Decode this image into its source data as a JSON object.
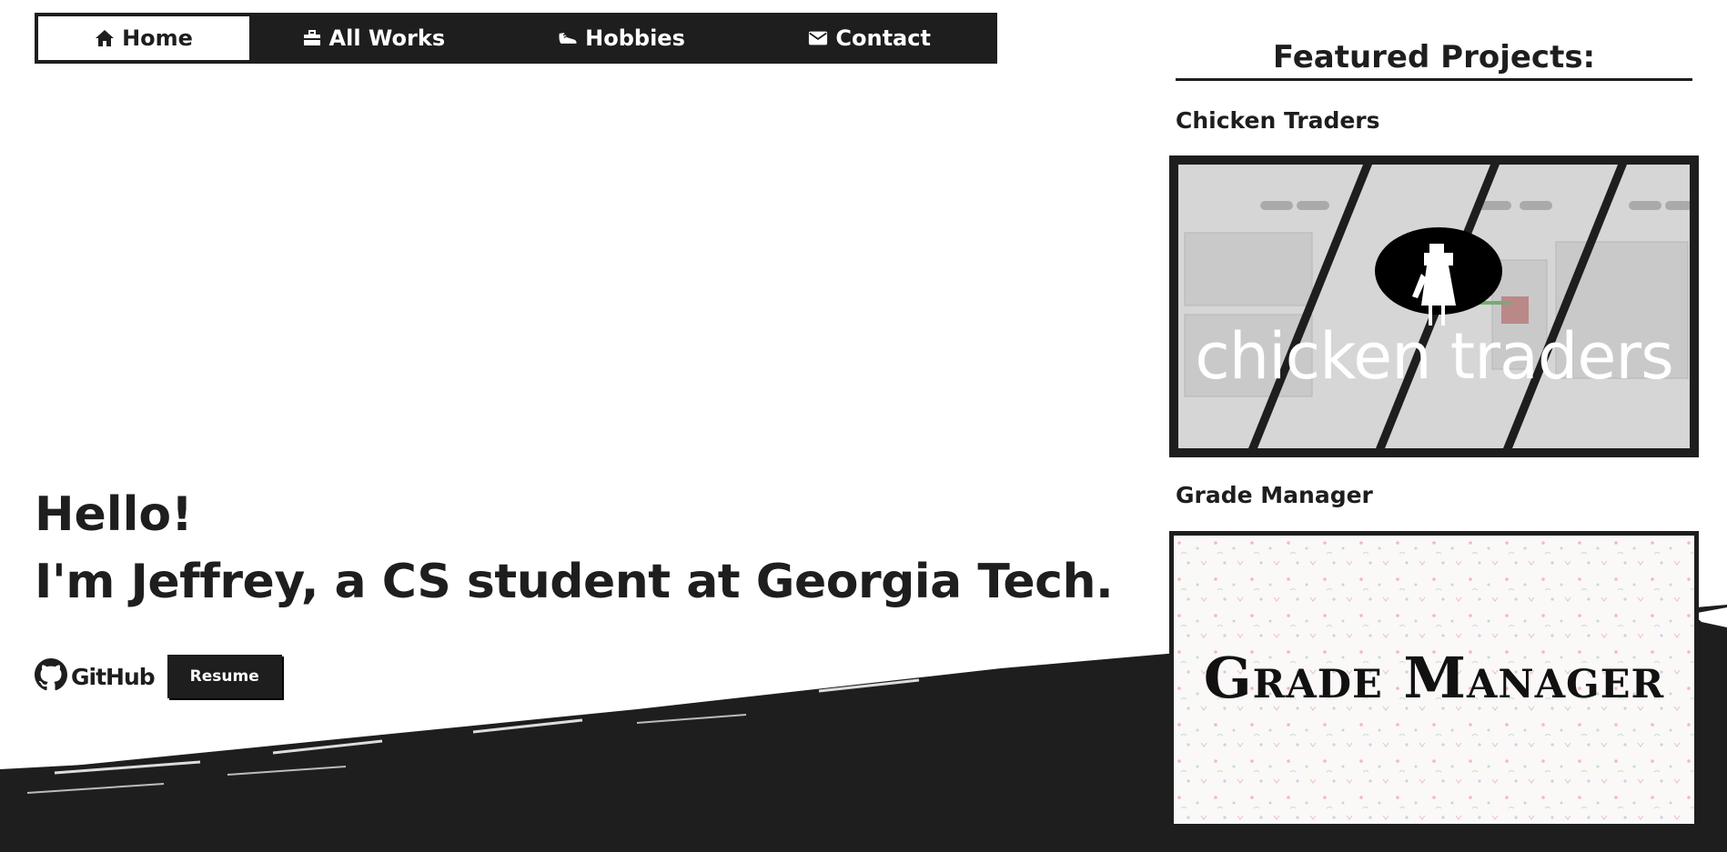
{
  "nav": {
    "items": [
      {
        "label": "Home",
        "icon": "home-icon",
        "active": true
      },
      {
        "label": "All Works",
        "icon": "briefcase-icon"
      },
      {
        "label": "Hobbies",
        "icon": "shoe-icon"
      },
      {
        "label": "Contact",
        "icon": "envelope-icon"
      }
    ]
  },
  "hero": {
    "greeting": "Hello!",
    "intro": "I'm Jeffrey, a CS student at Georgia Tech.",
    "github_label": "GitHub",
    "resume_label": "Resume"
  },
  "sidebar": {
    "title": "Featured Projects:",
    "projects": [
      {
        "name": "Chicken Traders",
        "image_text": "chicken traders"
      },
      {
        "name": "Grade Manager",
        "image_text": "Grade Manager"
      }
    ]
  },
  "colors": {
    "dark": "#1e1e1e",
    "light": "#ffffff"
  }
}
